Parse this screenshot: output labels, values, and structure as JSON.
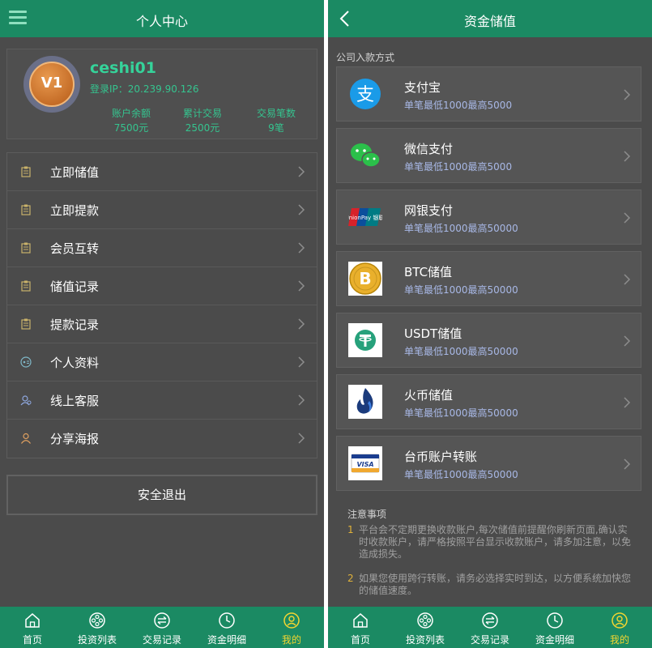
{
  "colors": {
    "brand_green": "#1b8a63",
    "accent_green": "#35d39a",
    "active_yellow": "#f2d531",
    "background": "#4b4b4b"
  },
  "profile_screen": {
    "title": "个人中心",
    "menu_icon": "hamburger-icon",
    "user": {
      "badge": "V1",
      "username": "ceshi01",
      "login_ip": "登录IP：20.239.90.126"
    },
    "stats": [
      {
        "label": "账户余额",
        "value": "7500元"
      },
      {
        "label": "累计交易",
        "value": "2500元"
      },
      {
        "label": "交易笔数",
        "value": "9笔"
      }
    ],
    "menu_items": [
      {
        "label": "立即储值",
        "icon": "document-icon"
      },
      {
        "label": "立即提款",
        "icon": "document-icon"
      },
      {
        "label": "会员互转",
        "icon": "document-icon"
      },
      {
        "label": "储值记录",
        "icon": "document-icon"
      },
      {
        "label": "提款记录",
        "icon": "document-icon"
      },
      {
        "label": "个人资料",
        "icon": "profile-icon"
      },
      {
        "label": "线上客服",
        "icon": "customer-service-icon"
      },
      {
        "label": "分享海报",
        "icon": "person-icon"
      }
    ],
    "logout_label": "安全退出"
  },
  "deposit_screen": {
    "title": "资金储值",
    "back_icon": "chevron-left-icon",
    "section_label": "公司入款方式",
    "methods": [
      {
        "name": "支付宝",
        "desc": "单笔最低1000最高5000",
        "icon": "alipay-icon"
      },
      {
        "name": "微信支付",
        "desc": "单笔最低1000最高5000",
        "icon": "wechat-pay-icon"
      },
      {
        "name": "网银支付",
        "desc": "单笔最低1000最高50000",
        "icon": "unionpay-icon",
        "icon_text": "UnionPay 银联"
      },
      {
        "name": "BTC储值",
        "desc": "单笔最低1000最高50000",
        "icon": "bitcoin-icon"
      },
      {
        "name": "USDT储值",
        "desc": "单笔最低1000最高50000",
        "icon": "tether-icon"
      },
      {
        "name": "火币储值",
        "desc": "单笔最低1000最高50000",
        "icon": "huobi-icon"
      },
      {
        "name": "台币账户转账",
        "desc": "单笔最低1000最高50000",
        "icon": "visa-card-icon",
        "icon_text": "VISA"
      }
    ],
    "notes_title": "注意事项",
    "notes": [
      {
        "num": "1",
        "text": "平台会不定期更换收款账户,每次储值前提醒你刷新页面,确认实时收款账户，请严格按照平台显示收款账户，请多加注意，以免造成损失。"
      },
      {
        "num": "2",
        "text": "如果您使用跨行转账，请务必选择实时到达，以方便系统加快您的储值速度。"
      }
    ]
  },
  "tabbar": {
    "tabs": [
      {
        "label": "首页",
        "icon": "home-icon"
      },
      {
        "label": "投资列表",
        "icon": "film-reel-icon"
      },
      {
        "label": "交易记录",
        "icon": "exchange-icon"
      },
      {
        "label": "资金明细",
        "icon": "clock-icon"
      },
      {
        "label": "我的",
        "icon": "user-circle-icon"
      }
    ],
    "active_tab": "我的"
  }
}
